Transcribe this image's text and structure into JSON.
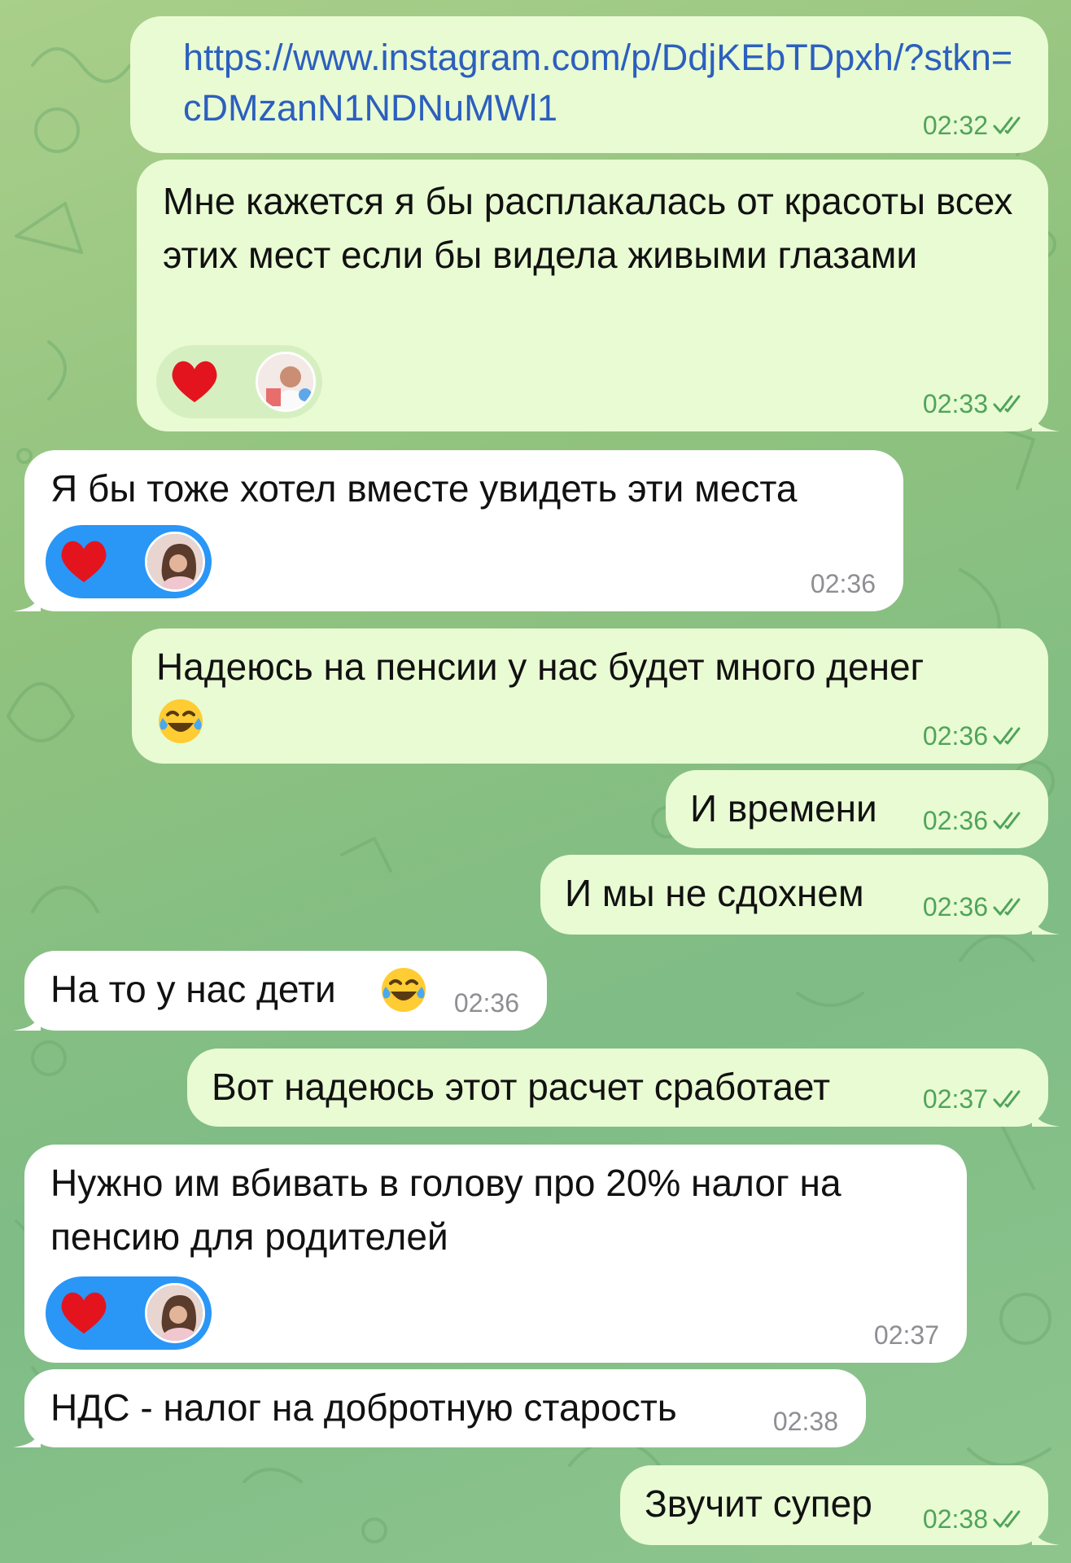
{
  "chat": {
    "messages": [
      {
        "id": "m1",
        "side": "out",
        "text": "https://www.instagram.com/p/DdjKEbTDpxh/?stkn=cDMzanN1NDNuMWl1",
        "time": "02:32",
        "read": true
      },
      {
        "id": "m2",
        "side": "out",
        "text": "Мне кажется я бы расплакалась от красоты всех этих мест если бы видела живыми глазами",
        "time": "02:33",
        "read": true,
        "reaction": {
          "emoji": "heart",
          "avatar": "avatar-man"
        }
      },
      {
        "id": "m3",
        "side": "in",
        "text": "Я бы тоже хотел вместе увидеть эти места",
        "time": "02:36",
        "reaction": {
          "emoji": "heart",
          "avatar": "avatar-woman"
        }
      },
      {
        "id": "m4",
        "side": "out",
        "text": "Надеюсь на пенсии у нас будет много денег",
        "emoji": "face-with-tears-of-joy",
        "time": "02:36",
        "read": true
      },
      {
        "id": "m5",
        "side": "out",
        "text": "И времени",
        "time": "02:36",
        "read": true
      },
      {
        "id": "m6",
        "side": "out",
        "text": "И мы не сдохнем",
        "time": "02:36",
        "read": true
      },
      {
        "id": "m7",
        "side": "in",
        "text": "На то у нас дети",
        "emoji": "face-with-tears-of-joy",
        "time": "02:36"
      },
      {
        "id": "m8",
        "side": "out",
        "text": "Вот надеюсь этот расчет сработает",
        "time": "02:37",
        "read": true
      },
      {
        "id": "m9",
        "side": "in",
        "text": "Нужно им вбивать в голову про 20% налог на пенсию для родителей",
        "time": "02:37",
        "reaction": {
          "emoji": "heart",
          "avatar": "avatar-woman"
        }
      },
      {
        "id": "m10",
        "side": "in",
        "text": "НДС - налог на добротную старость",
        "time": "02:38"
      },
      {
        "id": "m11",
        "side": "out",
        "text": "Звучит супер",
        "time": "02:38",
        "read": true
      }
    ]
  },
  "colors": {
    "outgoing_bubble": "#e9fbd3",
    "incoming_bubble": "#ffffff",
    "link": "#2c5fbe",
    "read_check": "#4fa45b",
    "incoming_time": "#8e8e93",
    "incoming_reaction": "#2a96f6",
    "heart": "#e4141e"
  }
}
